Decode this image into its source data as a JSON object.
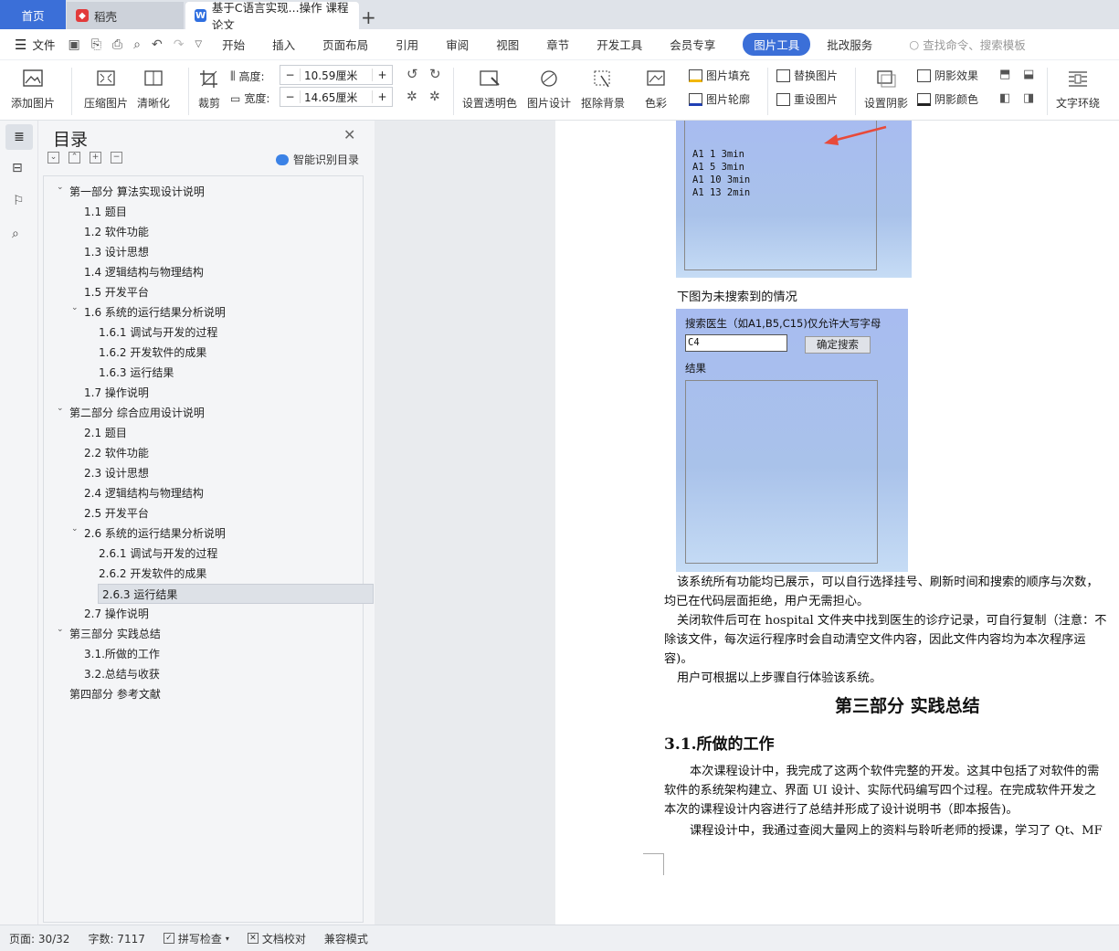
{
  "tabs": {
    "home": "首页",
    "daoke": "稻壳",
    "doc": "基于C语言实现...操作 课程论文",
    "add": "+"
  },
  "menu": {
    "file": "文件",
    "items": [
      "开始",
      "插入",
      "页面布局",
      "引用",
      "审阅",
      "视图",
      "章节",
      "开发工具",
      "会员专享",
      "图片工具",
      "批改服务"
    ],
    "active": "图片工具",
    "search_placeholder": "查找命令、搜索模板"
  },
  "ribbon": {
    "add_picture": "添加图片",
    "compress": "压缩图片",
    "sharpen": "清晰化",
    "crop": "裁剪",
    "height_label": "高度:",
    "height_value": "10.59厘米",
    "width_label": "宽度:",
    "width_value": "14.65厘米",
    "set_transparent": "设置透明色",
    "picture_design": "图片设计",
    "remove_bg": "抠除背景",
    "color": "色彩",
    "fill": "图片填充",
    "outline": "图片轮廓",
    "replace": "替换图片",
    "reset": "重设图片",
    "shadow_set": "设置阴影",
    "shadow_effect": "阴影效果",
    "shadow_color": "阴影颜色",
    "text_wrap": "文字环绕"
  },
  "toc": {
    "title": "目录",
    "smart": "智能识别目录",
    "items": [
      {
        "label": "第一部分  算法实现设计说明",
        "level": 0,
        "expanded": true
      },
      {
        "label": "1.1 题目",
        "level": 1
      },
      {
        "label": "1.2 软件功能",
        "level": 1
      },
      {
        "label": "1.3 设计思想",
        "level": 1
      },
      {
        "label": "1.4 逻辑结构与物理结构",
        "level": 1
      },
      {
        "label": "1.5 开发平台",
        "level": 1
      },
      {
        "label": "1.6 系统的运行结果分析说明",
        "level": 1,
        "expanded": true
      },
      {
        "label": "1.6.1  调试与开发的过程",
        "level": 2
      },
      {
        "label": "1.6.2  开发软件的成果",
        "level": 2
      },
      {
        "label": "1.6.3  运行结果",
        "level": 2
      },
      {
        "label": "1.7 操作说明",
        "level": 1
      },
      {
        "label": "第二部分  综合应用设计说明",
        "level": 0,
        "expanded": true
      },
      {
        "label": "2.1 题目",
        "level": 1
      },
      {
        "label": "2.2 软件功能",
        "level": 1
      },
      {
        "label": "2.3 设计思想",
        "level": 1
      },
      {
        "label": "2.4 逻辑结构与物理结构",
        "level": 1
      },
      {
        "label": "2.5 开发平台",
        "level": 1
      },
      {
        "label": "2.6 系统的运行结果分析说明",
        "level": 1,
        "expanded": true
      },
      {
        "label": "2.6.1  调试与开发的过程",
        "level": 2
      },
      {
        "label": "2.6.2  开发软件的成果",
        "level": 2
      },
      {
        "label": "2.6.3  运行结果",
        "level": 2,
        "selected": true
      },
      {
        "label": "2.7 操作说明",
        "level": 1
      },
      {
        "label": "第三部分  实践总结",
        "level": 0,
        "expanded": true
      },
      {
        "label": "3.1.所做的工作",
        "level": 1
      },
      {
        "label": "3.2.总结与收获",
        "level": 1
      },
      {
        "label": "第四部分  参考文献",
        "level": 0
      }
    ]
  },
  "doc": {
    "shot1_lines": [
      "A1 1 3min",
      "A1 5 3min",
      "A1 10 3min",
      "A1 13 2min"
    ],
    "caption_not_found": "下图为未搜索到的情况",
    "search_label": "搜索医生（如A1,B5,C15)仅允许大写字母",
    "search_value": "C4",
    "search_button": "确定搜索",
    "result_label": "结果",
    "para1_line1": "该系统所有功能均已展示，可以自行选择挂号、刷新时间和搜索的顺序与次数，",
    "para1_line2": "均已在代码层面拒绝，用户无需担心。",
    "para2_line1": "关闭软件后可在 hospital 文件夹中找到医生的诊疗记录，可自行复制（注意：不",
    "para2_line2": "除该文件，每次运行程序时会自动清空文件内容，因此文件内容均为本次程序运",
    "para2_line3": "容)。",
    "para3": "用户可根据以上步骤自行体验该系统。",
    "section_title": "第三部分  实践总结",
    "subsection": "3.1.所做的工作",
    "para4_line1": "本次课程设计中，我完成了这两个软件完整的开发。这其中包括了对软件的需",
    "para4_line2": "软件的系统架构建立、界面 UI 设计、实际代码编写四个过程。在完成软件开发之",
    "para4_line3": "本次的课程设计内容进行了总结并形成了设计说明书（即本报告)。",
    "para5_line1": "课程设计中，我通过查阅大量网上的资料与聆听老师的授课，学习了 Qt、MF"
  },
  "status": {
    "page": "页面: 30/32",
    "words": "字数: 7117",
    "spell": "拼写检查",
    "proof": "文档校对",
    "compat": "兼容模式"
  },
  "colors": {
    "accent": "#3b6fd8",
    "arrow": "#e84a3a"
  }
}
